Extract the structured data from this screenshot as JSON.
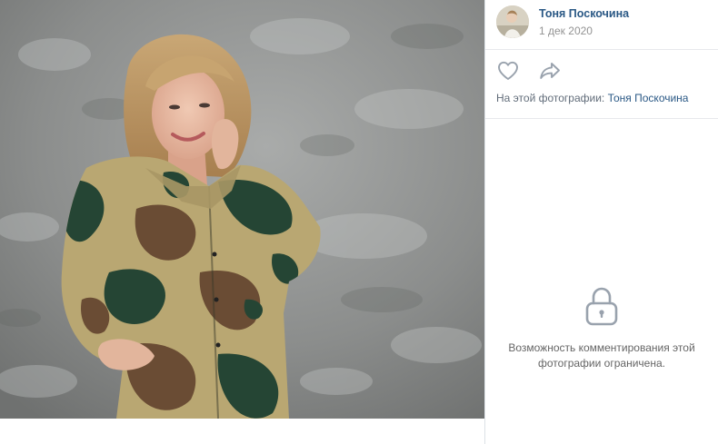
{
  "photo": {
    "description_icon": "photo-image"
  },
  "author": {
    "name": "Тоня Поскочина",
    "date": "1 дек 2020",
    "avatar_icon": "user-avatar"
  },
  "actions": {
    "like_icon": "heart-icon",
    "share_icon": "share-arrow-icon"
  },
  "tags": {
    "prefix": "На этой фотографии:",
    "person": "Тоня Поскочина"
  },
  "comments": {
    "lock_icon": "lock-icon",
    "restricted_line1": "Возможность комментирования этой",
    "restricted_line2": "фотографии ограничена."
  },
  "colors": {
    "link": "#2a5885",
    "muted": "#939393",
    "icon": "#99a2ad",
    "divider": "#e7e8ec"
  }
}
